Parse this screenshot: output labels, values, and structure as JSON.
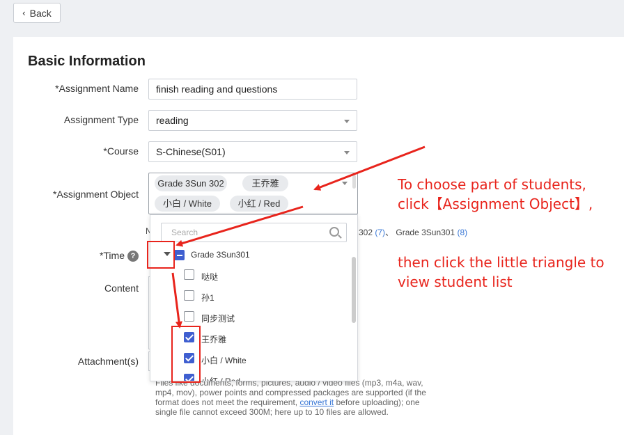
{
  "header": {
    "back_label": "Back"
  },
  "section": {
    "title": "Basic Information"
  },
  "form": {
    "assignment_name": {
      "label": "*Assignment Name",
      "value": "finish reading and questions"
    },
    "assignment_type": {
      "label": "Assignment Type",
      "value": "reading"
    },
    "course": {
      "label": "*Course",
      "value": "S-Chinese(S01)"
    },
    "assignment_object": {
      "label": "*Assignment Object",
      "tags": [
        "Grade 3Sun 302",
        "王乔雅",
        "小白 / White",
        "小红 / Red"
      ]
    },
    "summary": {
      "prefix": "N",
      "part1": "302",
      "count1": "(7)",
      "sep": "、",
      "part2": "Grade 3Sun301",
      "count2": "(8)"
    },
    "time": {
      "label": "*Time",
      "help": "?"
    },
    "content": {
      "label": "Content"
    },
    "attachments": {
      "label": "Attachment(s)",
      "note_before": "Files like documents, forms, pictures, audio / video files (mp3, m4a, wav, mp4, mov), power points and compressed packages are supported (if the format does not meet the requirement, ",
      "note_link": "convert it",
      "note_after": " before uploading); one single file cannot exceed 300M; here up to 10 files are allowed."
    }
  },
  "dropdown": {
    "search_placeholder": "Search",
    "group": "Grade 3Sun301",
    "students": [
      {
        "name": "哒哒",
        "checked": false
      },
      {
        "name": "孙1",
        "checked": false
      },
      {
        "name": "同步测试",
        "checked": false
      },
      {
        "name": "王乔雅",
        "checked": true
      },
      {
        "name": "小白 / White",
        "checked": true
      },
      {
        "name": "小红 / Red",
        "checked": true
      }
    ]
  },
  "annotations": {
    "line1": "To choose part of students,",
    "line2": "click【Assignment Object】,",
    "line3": "then click the little triangle to",
    "line4": "view student list"
  },
  "colors": {
    "annotation_red": "#e8241c",
    "checkbox_blue": "#3f5fd0",
    "link_blue": "#3a78d6"
  }
}
